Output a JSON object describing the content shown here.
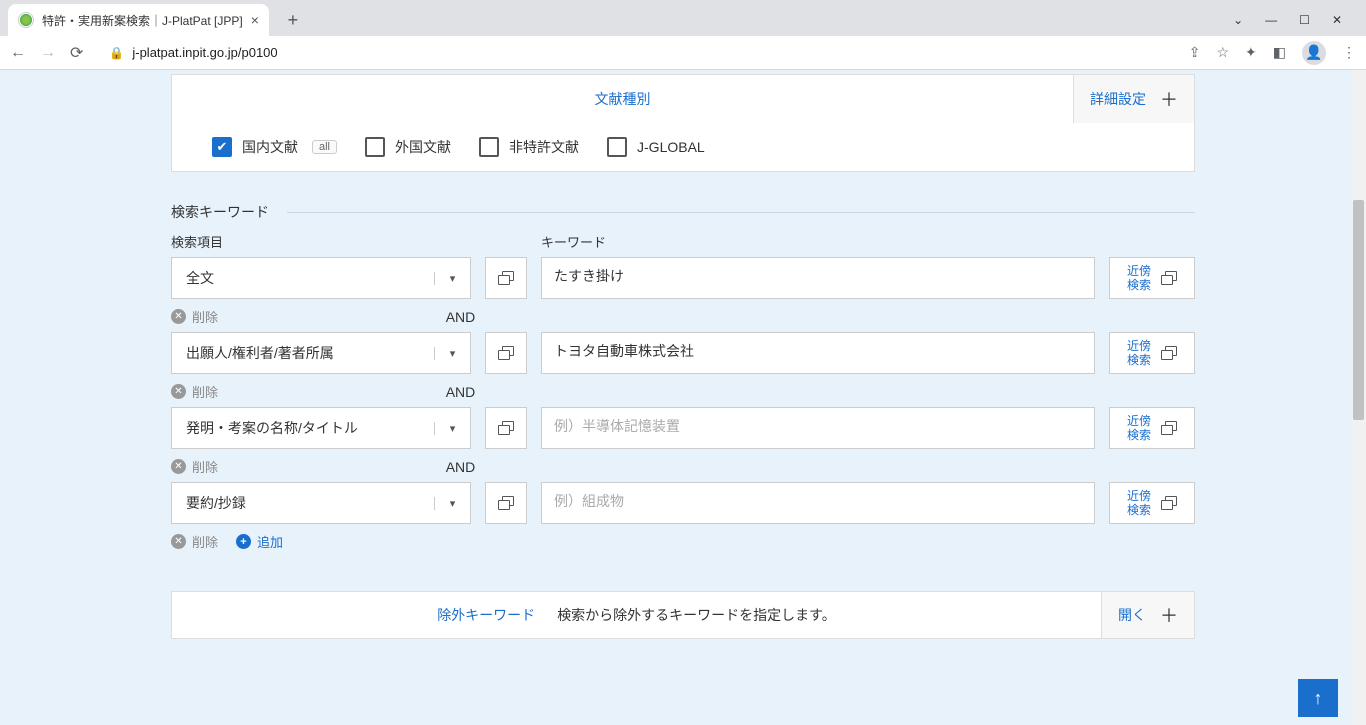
{
  "browser": {
    "tab_title": "特許・実用新案検索｜J-PlatPat [JPP]",
    "url": "j-platpat.inpit.go.jp/p0100"
  },
  "panel": {
    "title": "文献種別",
    "detail": "詳細設定"
  },
  "checkboxes": {
    "domestic": "国内文献",
    "all_badge": "all",
    "foreign": "外国文献",
    "nonpatent": "非特許文献",
    "jglobal": "J-GLOBAL"
  },
  "section": {
    "title": "検索キーワード",
    "item_label": "検索項目",
    "keyword_label": "キーワード"
  },
  "rows": [
    {
      "item": "全文",
      "value": "たすき掛け",
      "placeholder": ""
    },
    {
      "item": "出願人/権利者/著者所属",
      "value": "トヨタ自動車株式会社",
      "placeholder": ""
    },
    {
      "item": "発明・考案の名称/タイトル",
      "value": "",
      "placeholder": "例）半導体記憶装置"
    },
    {
      "item": "要約/抄録",
      "value": "",
      "placeholder": "例）組成物"
    }
  ],
  "labels": {
    "delete": "削除",
    "add": "追加",
    "and": "AND",
    "proximity": "近傍\n検索"
  },
  "exclude": {
    "title": "除外キーワード",
    "subtitle": "検索から除外するキーワードを指定します。",
    "open": "開く"
  }
}
